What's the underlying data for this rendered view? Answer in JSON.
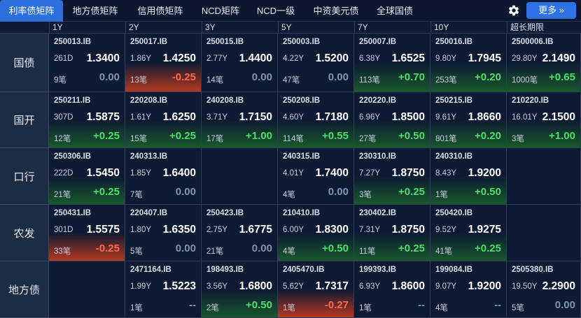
{
  "nav": {
    "tabs": [
      "利率债矩阵",
      "地方债矩阵",
      "信用债矩阵",
      "NCD矩阵",
      "NCD一级",
      "中资美元债",
      "全球国债"
    ],
    "active_index": 0,
    "more_label": "更多 »"
  },
  "columns": [
    "1Y",
    "2Y",
    "3Y",
    "5Y",
    "7Y",
    "10Y",
    "超长期限"
  ],
  "rows": [
    {
      "label": "国债",
      "cells": [
        {
          "code": "250013.IB",
          "tenor": "261D",
          "yield": "1.3400",
          "count": "9笔",
          "change": "0.00",
          "trend": "flat"
        },
        {
          "code": "250017.IB",
          "tenor": "1.86Y",
          "yield": "1.4250",
          "count": "13笔",
          "change": "-0.25",
          "trend": "down"
        },
        {
          "code": "250015.IB",
          "tenor": "2.77Y",
          "yield": "1.4400",
          "count": "14笔",
          "change": "0.00",
          "trend": "flat"
        },
        {
          "code": "250003.IB",
          "tenor": "4.22Y",
          "yield": "1.5200",
          "count": "47笔",
          "change": "0.00",
          "trend": "flat"
        },
        {
          "code": "250007.IB",
          "tenor": "6.38Y",
          "yield": "1.6525",
          "count": "113笔",
          "change": "+0.70",
          "trend": "up"
        },
        {
          "code": "250016.IB",
          "tenor": "9.80Y",
          "yield": "1.7945",
          "count": "253笔",
          "change": "+0.20",
          "trend": "up"
        },
        {
          "code": "2500006.IB",
          "tenor": "29.80Y",
          "yield": "2.1490",
          "count": "1000笔",
          "change": "+0.65",
          "trend": "up"
        }
      ]
    },
    {
      "label": "国开",
      "cells": [
        {
          "code": "250211.IB",
          "tenor": "307D",
          "yield": "1.5875",
          "count": "12笔",
          "change": "+0.25",
          "trend": "up"
        },
        {
          "code": "220208.IB",
          "tenor": "1.61Y",
          "yield": "1.6250",
          "count": "15笔",
          "change": "+0.25",
          "trend": "up"
        },
        {
          "code": "240208.IB",
          "tenor": "3.71Y",
          "yield": "1.7150",
          "count": "17笔",
          "change": "+1.00",
          "trend": "up"
        },
        {
          "code": "250208.IB",
          "tenor": "4.60Y",
          "yield": "1.7180",
          "count": "114笔",
          "change": "+0.55",
          "trend": "up"
        },
        {
          "code": "220220.IB",
          "tenor": "6.96Y",
          "yield": "1.8500",
          "count": "27笔",
          "change": "+0.50",
          "trend": "up"
        },
        {
          "code": "250215.IB",
          "tenor": "9.61Y",
          "yield": "1.8660",
          "count": "801笔",
          "change": "+0.20",
          "trend": "up"
        },
        {
          "code": "210220.IB",
          "tenor": "16.01Y",
          "yield": "2.1500",
          "count": "3笔",
          "change": "+1.00",
          "trend": "up"
        }
      ]
    },
    {
      "label": "口行",
      "cells": [
        {
          "code": "250306.IB",
          "tenor": "222D",
          "yield": "1.5450",
          "count": "21笔",
          "change": "+0.25",
          "trend": "up"
        },
        {
          "code": "240313.IB",
          "tenor": "1.85Y",
          "yield": "1.6400",
          "count": "7笔",
          "change": "0.00",
          "trend": "flat"
        },
        null,
        {
          "code": "240315.IB",
          "tenor": "4.01Y",
          "yield": "1.7400",
          "count": "4笔",
          "change": "0.00",
          "trend": "flat"
        },
        {
          "code": "230310.IB",
          "tenor": "7.27Y",
          "yield": "1.8750",
          "count": "3笔",
          "change": "+0.25",
          "trend": "up"
        },
        {
          "code": "240310.IB",
          "tenor": "8.43Y",
          "yield": "1.9200",
          "count": "1笔",
          "change": "+0.50",
          "trend": "up"
        },
        null
      ]
    },
    {
      "label": "农发",
      "cells": [
        {
          "code": "250431.IB",
          "tenor": "301D",
          "yield": "1.5575",
          "count": "33笔",
          "change": "-0.25",
          "trend": "down"
        },
        {
          "code": "220407.IB",
          "tenor": "1.80Y",
          "yield": "1.6350",
          "count": "5笔",
          "change": "0.00",
          "trend": "flat"
        },
        {
          "code": "250423.IB",
          "tenor": "2.75Y",
          "yield": "1.6775",
          "count": "21笔",
          "change": "0.00",
          "trend": "flat"
        },
        {
          "code": "210410.IB",
          "tenor": "6.00Y",
          "yield": "1.8300",
          "count": "4笔",
          "change": "+0.50",
          "trend": "up"
        },
        {
          "code": "230402.IB",
          "tenor": "7.31Y",
          "yield": "1.8750",
          "count": "11笔",
          "change": "+0.25",
          "trend": "up"
        },
        {
          "code": "250420.IB",
          "tenor": "9.52Y",
          "yield": "1.9275",
          "count": "41笔",
          "change": "+0.25",
          "trend": "up"
        },
        null
      ]
    },
    {
      "label": "地方债",
      "cells": [
        null,
        {
          "code": "2471164.IB",
          "tenor": "1.99Y",
          "yield": "1.5223",
          "count": "1笔",
          "change": "--",
          "trend": "flat"
        },
        {
          "code": "198493.IB",
          "tenor": "3.56Y",
          "yield": "1.6800",
          "count": "2笔",
          "change": "+0.50",
          "trend": "up"
        },
        {
          "code": "2405470.IB",
          "tenor": "5.62Y",
          "yield": "1.7317",
          "count": "1笔",
          "change": "-0.27",
          "trend": "down"
        },
        {
          "code": "199393.IB",
          "tenor": "6.93Y",
          "yield": "1.8600",
          "count": "1笔",
          "change": "--",
          "trend": "flat"
        },
        {
          "code": "199084.IB",
          "tenor": "9.07Y",
          "yield": "1.9200",
          "count": "4笔",
          "change": "--",
          "trend": "flat"
        },
        {
          "code": "2505380.IB",
          "tenor": "19.50Y",
          "yield": "2.2900",
          "count": "5笔",
          "change": "0.00",
          "trend": "flat"
        }
      ]
    }
  ],
  "colors": {
    "accent": "#2e6fe0",
    "up": "#4dde6b",
    "down": "#ff6a4a",
    "flat": "#8094b4"
  },
  "icons": {
    "settings": "gear-icon",
    "more": "double-chevron-right-icon"
  }
}
